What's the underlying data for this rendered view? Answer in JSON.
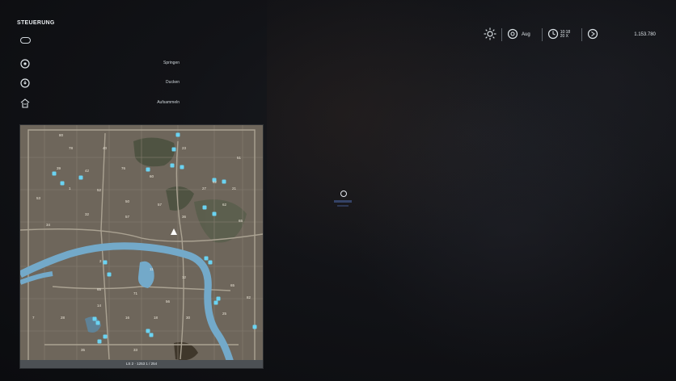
{
  "controls": {
    "title": "STEUERUNG",
    "items": [
      {
        "label": "",
        "icon": "keycap-icon"
      },
      {
        "label": "Springen",
        "icon": "button-a-icon"
      },
      {
        "label": "Ducken",
        "icon": "button-b-icon"
      },
      {
        "label": "Aufsammeln",
        "icon": "hand-grab-icon"
      }
    ]
  },
  "hud": {
    "weather_icon": "sun-icon",
    "season_icon": "gear-icon",
    "month": "Aug",
    "time": "10:18",
    "day": "20 X",
    "money": "1.153.780"
  },
  "map": {
    "footer_text": "LS 2 · 1253 1 / 254",
    "field_numbers": [
      "80",
      "78",
      "40",
      "23",
      "51",
      "39",
      "42",
      "76",
      "60",
      "62",
      "1",
      "52",
      "50",
      "57",
      "62",
      "53",
      "32",
      "57",
      "34",
      "36",
      "21",
      "27",
      "65",
      "2",
      "11",
      "12",
      "65",
      "71",
      "56",
      "65",
      "7",
      "28",
      "14",
      "16",
      "18",
      "30",
      "25",
      "35",
      "33",
      "82"
    ],
    "colors": {
      "land": "#6e665b",
      "water": "#73a9c9",
      "forest": "#3c4f36",
      "road": "#9a9386",
      "poi": "#6ad3f2"
    }
  },
  "player": {
    "marker_icon": "player-position-icon"
  }
}
